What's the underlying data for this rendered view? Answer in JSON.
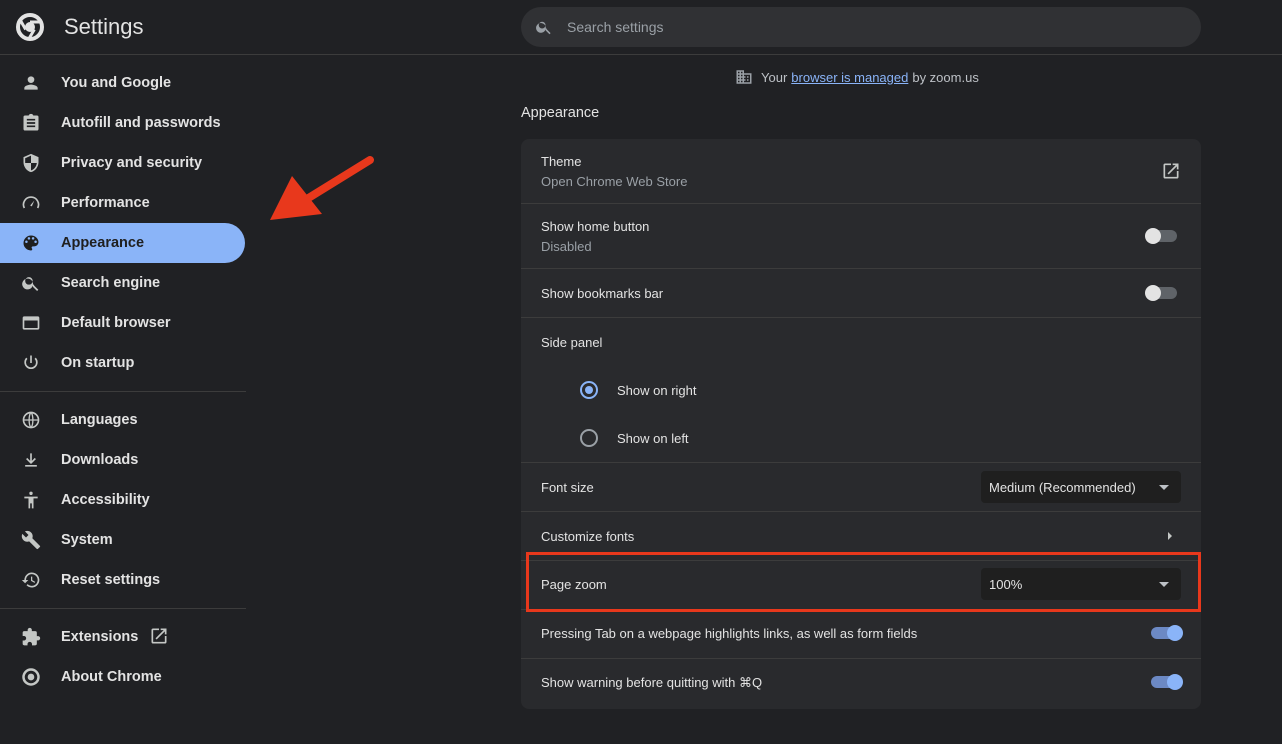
{
  "app": {
    "title": "Settings"
  },
  "search": {
    "placeholder": "Search settings"
  },
  "sidebar": {
    "items": [
      {
        "label": "You and Google",
        "icon": "person-icon"
      },
      {
        "label": "Autofill and passwords",
        "icon": "clipboard-icon"
      },
      {
        "label": "Privacy and security",
        "icon": "shield-icon"
      },
      {
        "label": "Performance",
        "icon": "speedometer-icon"
      },
      {
        "label": "Appearance",
        "icon": "palette-icon",
        "active": true
      },
      {
        "label": "Search engine",
        "icon": "search-icon"
      },
      {
        "label": "Default browser",
        "icon": "browser-window-icon"
      },
      {
        "label": "On startup",
        "icon": "power-icon"
      },
      {
        "label": "Languages",
        "icon": "globe-icon"
      },
      {
        "label": "Downloads",
        "icon": "download-icon"
      },
      {
        "label": "Accessibility",
        "icon": "accessibility-icon"
      },
      {
        "label": "System",
        "icon": "wrench-icon"
      },
      {
        "label": "Reset settings",
        "icon": "reset-history-icon"
      },
      {
        "label": "Extensions",
        "icon": "puzzle-icon"
      },
      {
        "label": "About Chrome",
        "icon": "chrome-logo-icon"
      }
    ]
  },
  "managed_notice": {
    "prefix": "Your",
    "link": "browser is managed",
    "suffix": "by zoom.us"
  },
  "appearance": {
    "section_title": "Appearance",
    "theme": {
      "title": "Theme",
      "subtitle": "Open Chrome Web Store"
    },
    "home_button": {
      "title": "Show home button",
      "subtitle": "Disabled",
      "enabled": false
    },
    "bookmarks_bar": {
      "title": "Show bookmarks bar",
      "enabled": false
    },
    "side_panel": {
      "title": "Side panel",
      "options": [
        "Show on right",
        "Show on left"
      ],
      "selected": "Show on right"
    },
    "font_size": {
      "title": "Font size",
      "value": "Medium (Recommended)"
    },
    "customize_fonts": {
      "title": "Customize fonts"
    },
    "page_zoom": {
      "title": "Page zoom",
      "value": "100%"
    },
    "tab_highlight": {
      "title": "Pressing Tab on a webpage highlights links, as well as form fields",
      "enabled": true
    },
    "quit_warning": {
      "title": "Show warning before quitting with ⌘Q",
      "enabled": true
    }
  },
  "colors": {
    "background": "#202124",
    "card": "#292a2d",
    "accent": "#8ab4f8",
    "annotation": "#e8381c"
  }
}
